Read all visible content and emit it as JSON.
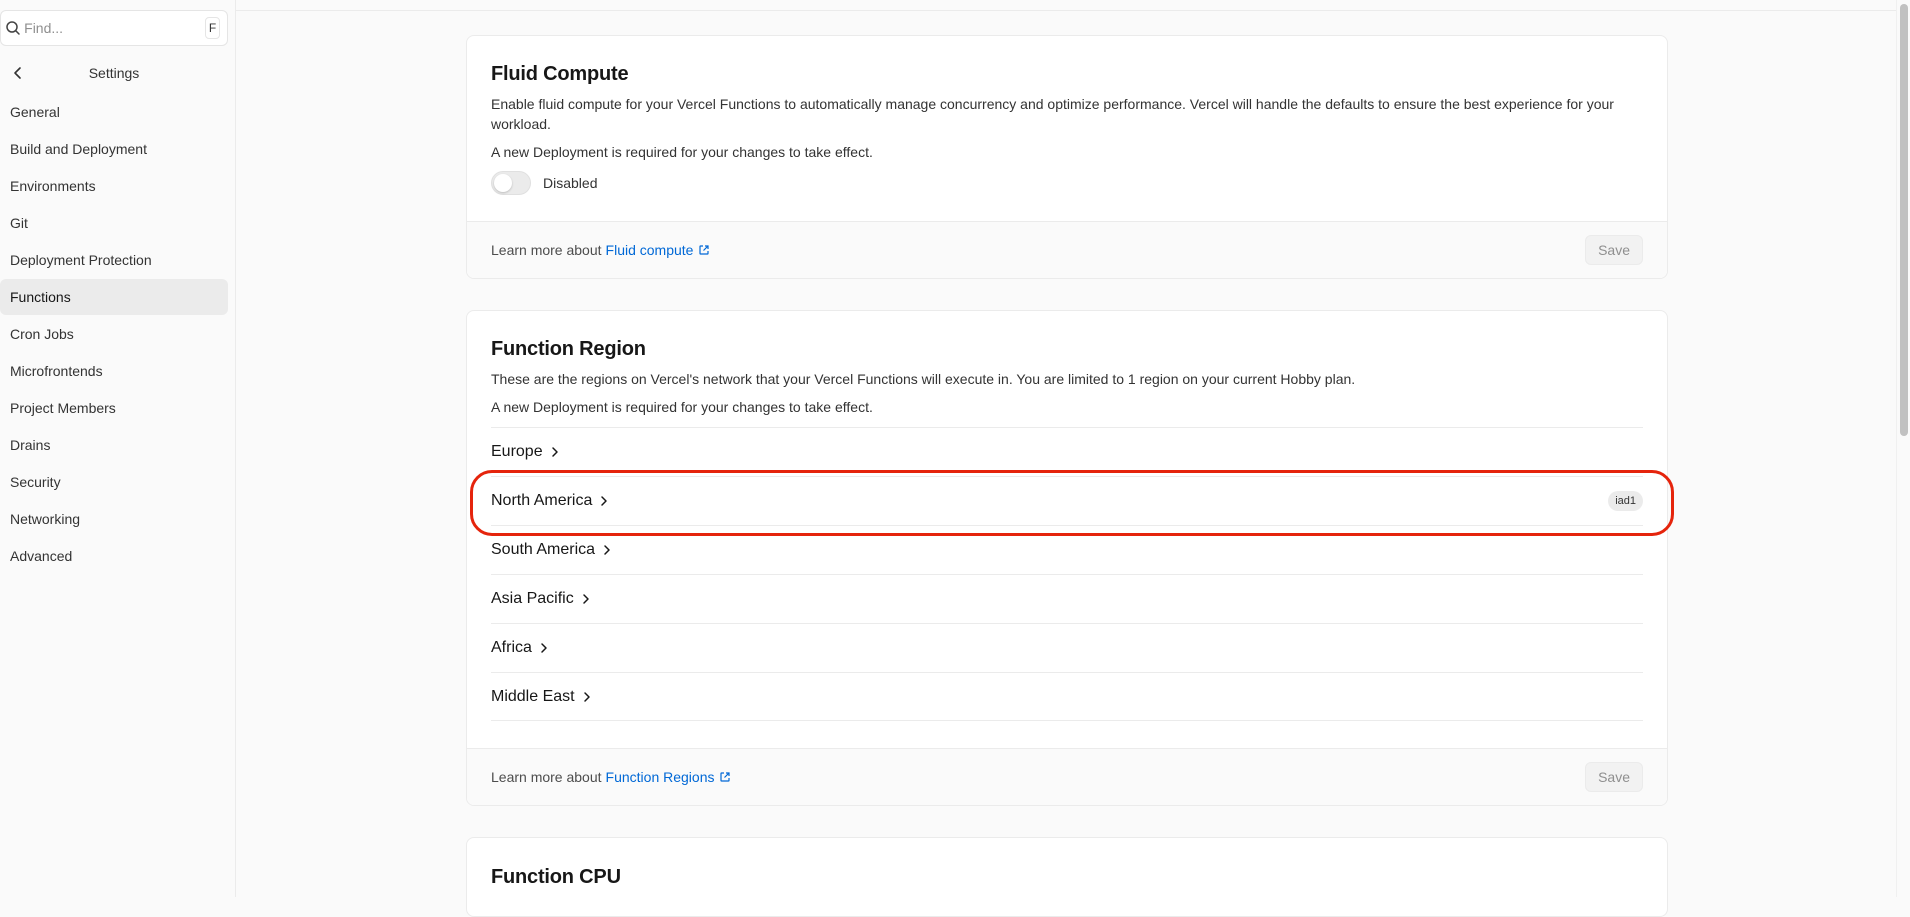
{
  "sidebar": {
    "search_placeholder": "Find...",
    "search_shortcut": "F",
    "title": "Settings",
    "items": [
      {
        "label": "General"
      },
      {
        "label": "Build and Deployment"
      },
      {
        "label": "Environments"
      },
      {
        "label": "Git"
      },
      {
        "label": "Deployment Protection"
      },
      {
        "label": "Functions",
        "active": true
      },
      {
        "label": "Cron Jobs"
      },
      {
        "label": "Microfrontends"
      },
      {
        "label": "Project Members"
      },
      {
        "label": "Drains"
      },
      {
        "label": "Security"
      },
      {
        "label": "Networking"
      },
      {
        "label": "Advanced"
      }
    ]
  },
  "fluid": {
    "title": "Fluid Compute",
    "description": "Enable fluid compute for your Vercel Functions to automatically manage concurrency and optimize performance. Vercel will handle the defaults to ensure the best experience for your workload.",
    "note": "A new Deployment is required for your changes to take effect.",
    "toggle_label": "Disabled",
    "toggle_on": false,
    "footer_text": "Learn more about",
    "footer_link": "Fluid compute",
    "save_label": "Save"
  },
  "region": {
    "title": "Function Region",
    "description": "These are the regions on Vercel's network that your Vercel Functions will execute in. You are limited to 1 region on your current Hobby plan.",
    "note": "A new Deployment is required for your changes to take effect.",
    "rows": [
      {
        "name": "Europe",
        "badge": ""
      },
      {
        "name": "North America",
        "badge": "iad1"
      },
      {
        "name": "South America",
        "badge": ""
      },
      {
        "name": "Asia Pacific",
        "badge": ""
      },
      {
        "name": "Africa",
        "badge": ""
      },
      {
        "name": "Middle East",
        "badge": ""
      }
    ],
    "footer_text": "Learn more about",
    "footer_link": "Function Regions",
    "save_label": "Save"
  },
  "cpu": {
    "title": "Function CPU"
  },
  "colors": {
    "link": "#0068d6",
    "highlight": "#e5240c",
    "active_nav": "#ebebeb"
  }
}
